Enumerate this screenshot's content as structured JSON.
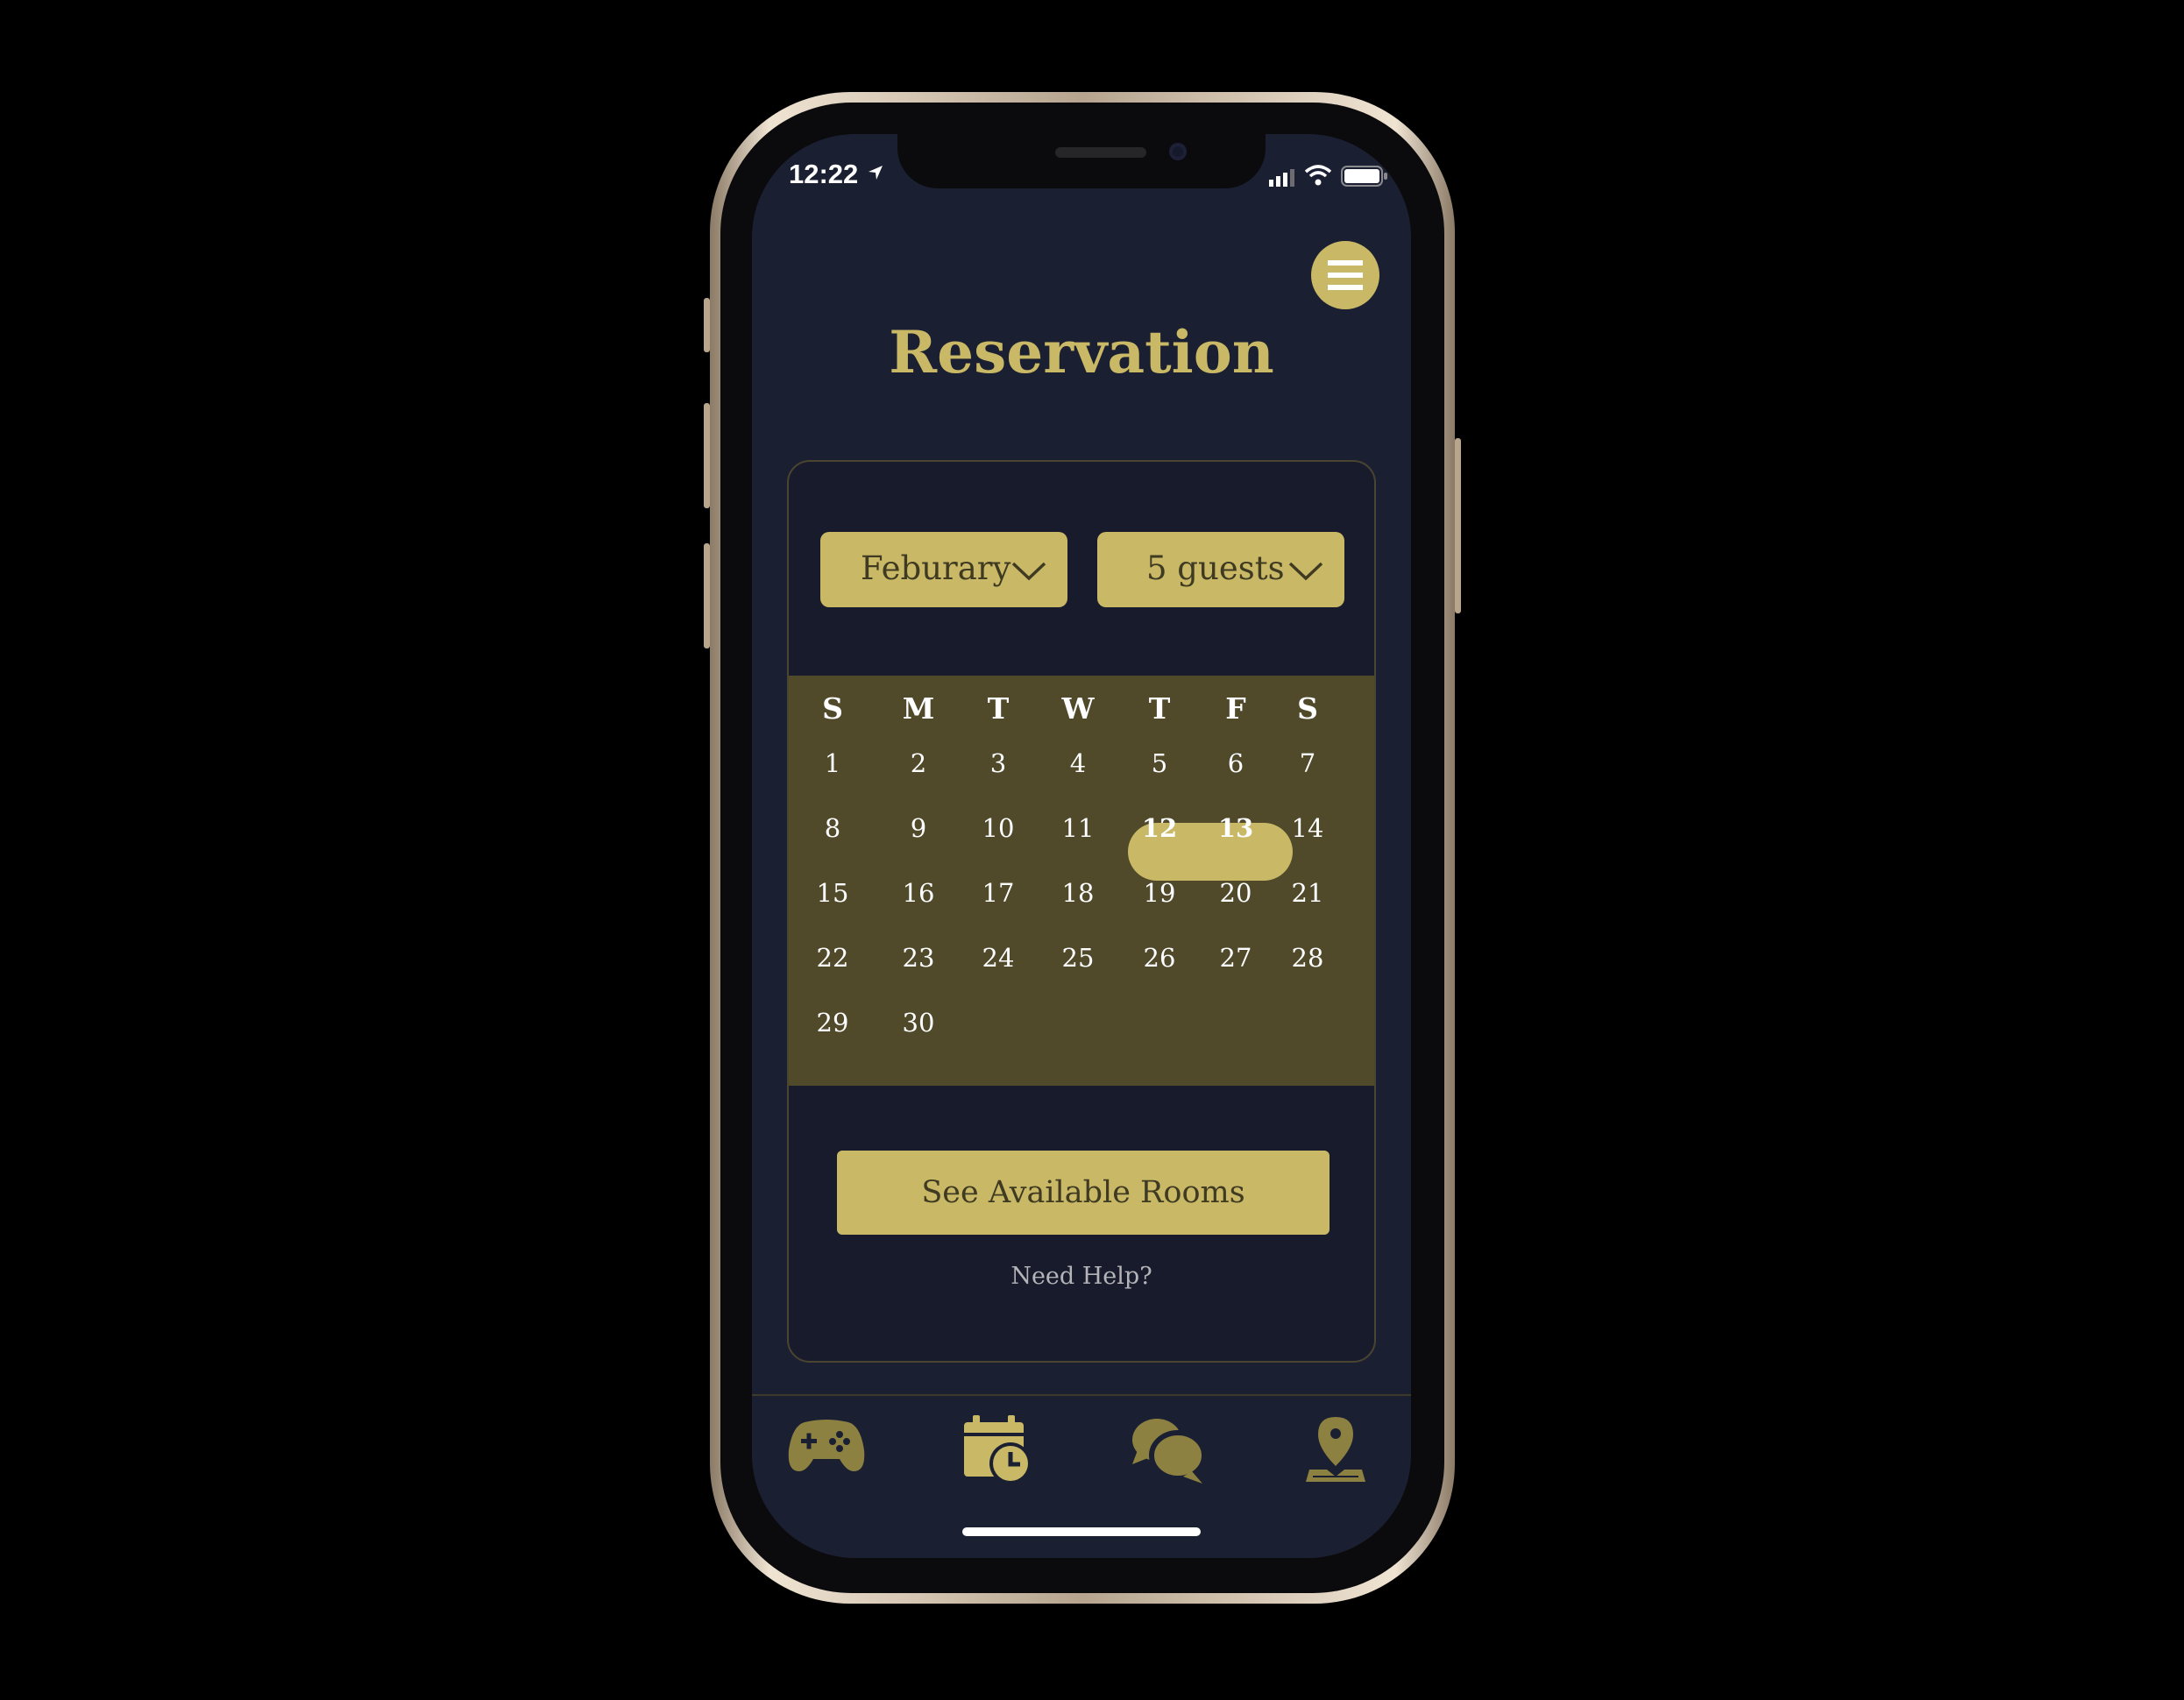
{
  "status": {
    "time": "12:22"
  },
  "header": {
    "title": "Reservation"
  },
  "filters": {
    "month": "Feburary",
    "guests": "5 guests"
  },
  "calendar": {
    "weekdays": [
      "S",
      "M",
      "T",
      "W",
      "T",
      "F",
      "S"
    ],
    "days": [
      "1",
      "2",
      "3",
      "4",
      "5",
      "6",
      "7",
      "8",
      "9",
      "10",
      "11",
      "12",
      "13",
      "14",
      "15",
      "16",
      "17",
      "18",
      "19",
      "20",
      "21",
      "22",
      "23",
      "24",
      "25",
      "26",
      "27",
      "28",
      "29",
      "30"
    ],
    "first_weekday_index": 0,
    "selected_range": [
      "12",
      "13"
    ]
  },
  "actions": {
    "see_rooms": "See Available Rooms",
    "help": "Need Help?"
  },
  "tabbar": {
    "items": [
      {
        "icon": "gamepad-icon",
        "active": false
      },
      {
        "icon": "calendar-clock-icon",
        "active": true
      },
      {
        "icon": "chat-bubbles-icon",
        "active": false
      },
      {
        "icon": "map-pin-icon",
        "active": false
      }
    ]
  },
  "colors": {
    "accent": "#c9b865",
    "background": "#1b1f32",
    "calendar_bg": "#504a2b",
    "inactive_icon": "#8c8140"
  }
}
